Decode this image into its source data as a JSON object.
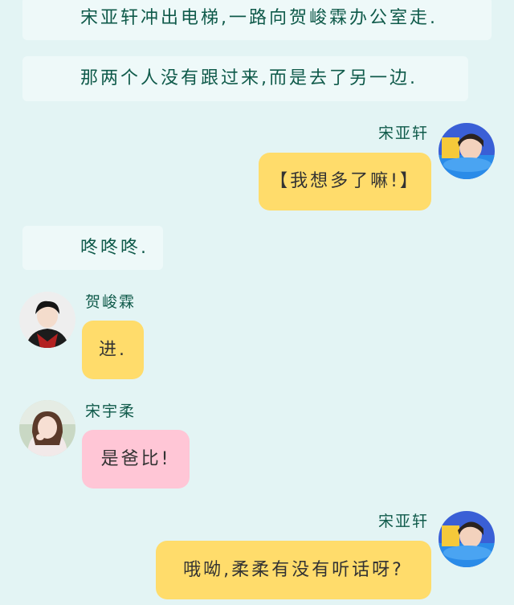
{
  "narration": [
    "宋亚轩冲出电梯,一路向贺峻霖办公室走.",
    "那两个人没有跟过来,而是去了另一边.",
    "咚咚咚."
  ],
  "messages": [
    {
      "sender": "宋亚轩",
      "text": "【我想多了嘛!】",
      "side": "right",
      "bubble_color": "#ffdc6b",
      "avatar": "avatar-song-yaxuan"
    },
    {
      "sender": "贺峻霖",
      "text": "进.",
      "side": "left",
      "bubble_color": "#ffdc6b",
      "avatar": "avatar-he-junlin"
    },
    {
      "sender": "宋宇柔",
      "text": "是爸比!",
      "side": "left",
      "bubble_color": "#ffc6d6",
      "avatar": "avatar-song-yurou"
    },
    {
      "sender": "宋亚轩",
      "text": "哦呦,柔柔有没有听话呀?",
      "side": "right",
      "bubble_color": "#ffdc6b",
      "avatar": "avatar-song-yaxuan"
    }
  ],
  "colors": {
    "background": "#e3f4f4",
    "narration_bg": "#eef9f9",
    "text_green": "#0f5a4a",
    "yellow_bubble": "#ffdc6b",
    "pink_bubble": "#ffc6d6"
  }
}
